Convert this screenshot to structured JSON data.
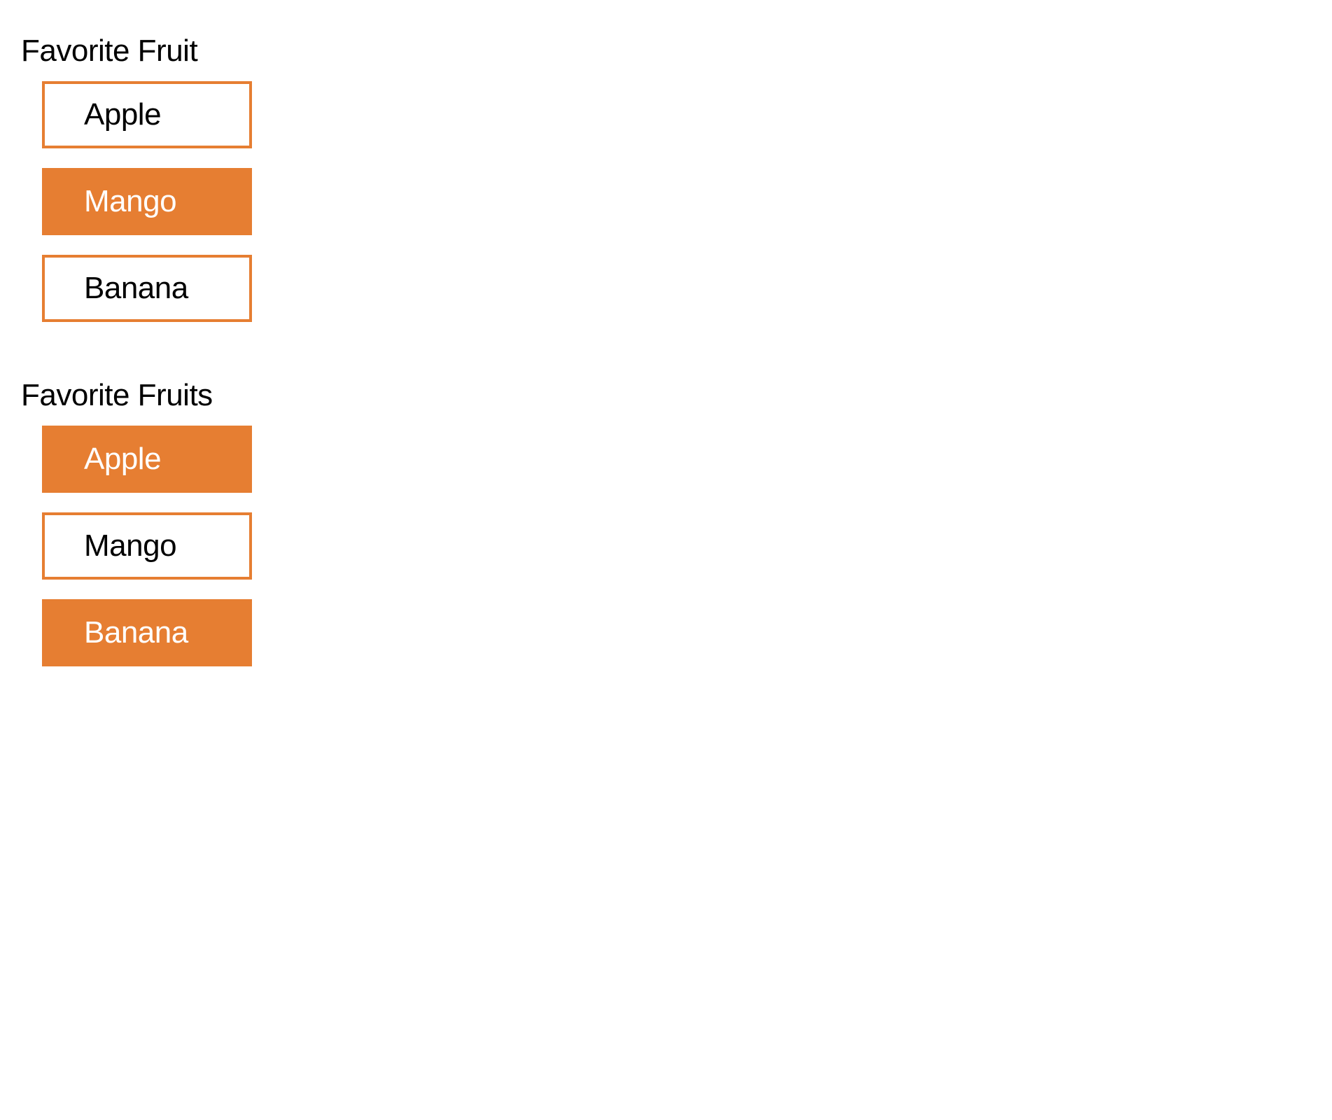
{
  "colors": {
    "accent": "#e67e32"
  },
  "groups": {
    "single": {
      "title": "Favorite Fruit",
      "options": [
        {
          "label": "Apple",
          "selected": false
        },
        {
          "label": "Mango",
          "selected": true
        },
        {
          "label": "Banana",
          "selected": false
        }
      ]
    },
    "multi": {
      "title": "Favorite Fruits",
      "options": [
        {
          "label": "Apple",
          "selected": true
        },
        {
          "label": "Mango",
          "selected": false
        },
        {
          "label": "Banana",
          "selected": true
        }
      ]
    }
  }
}
